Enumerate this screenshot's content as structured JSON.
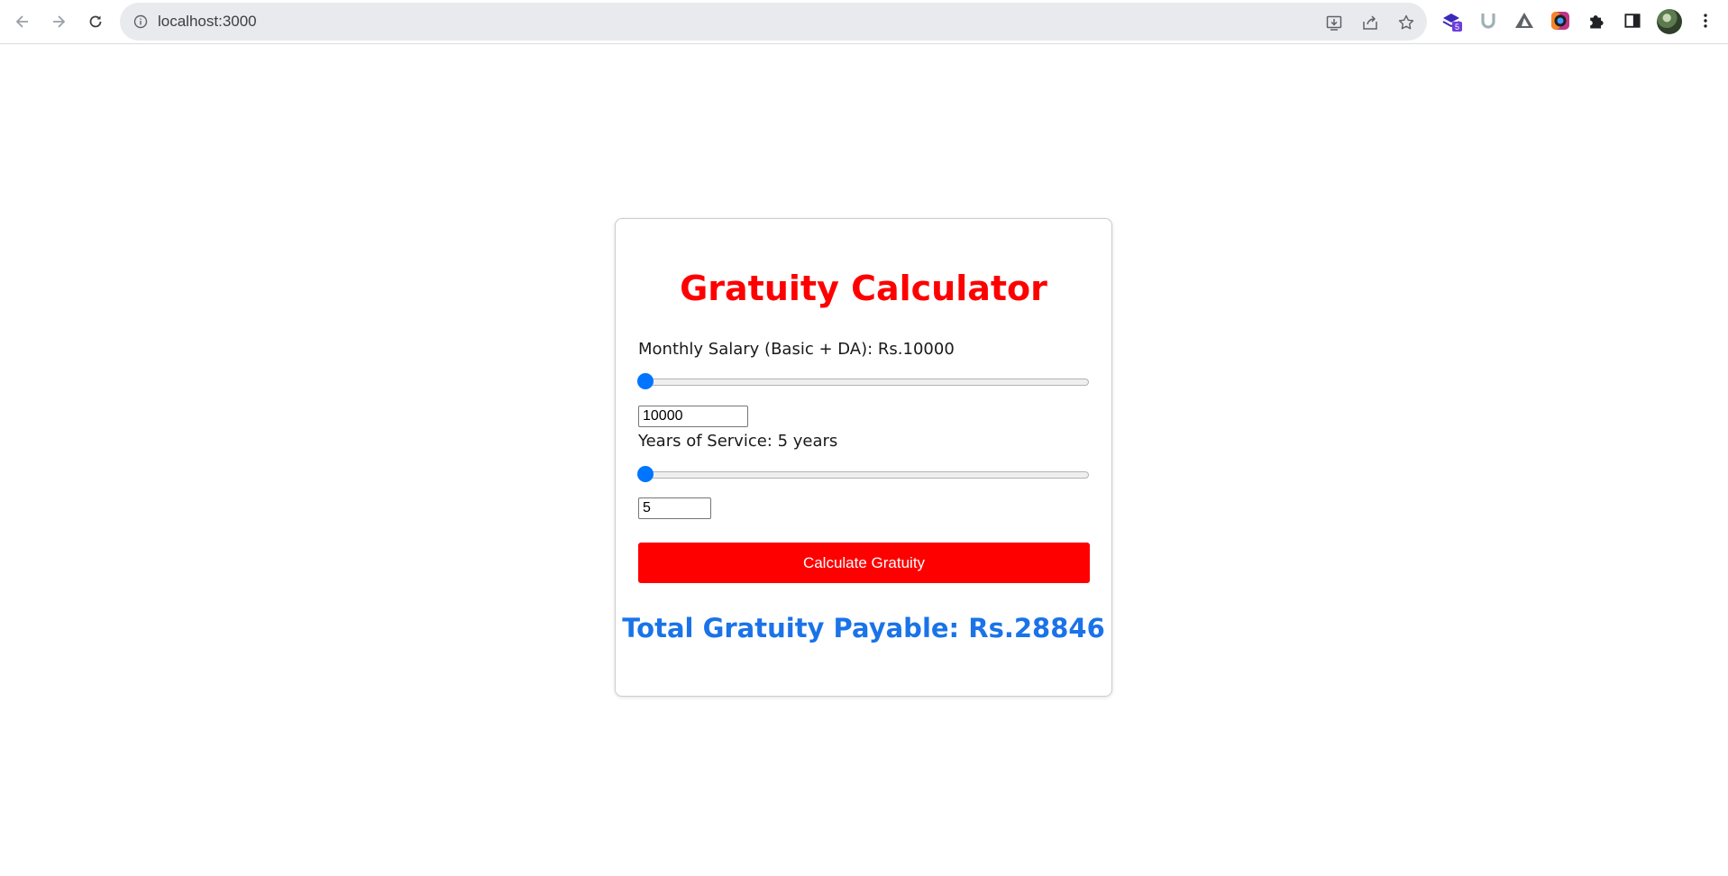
{
  "browser": {
    "url": "localhost:3000",
    "icons": {
      "back": "back-arrow-icon",
      "forward": "forward-arrow-icon",
      "reload": "reload-icon",
      "info": "info-icon",
      "install": "install-app-icon",
      "share": "share-icon",
      "bookmark": "star-icon"
    },
    "extensions": [
      "extension-stack-icon",
      "extension-u-icon",
      "extension-triangle-icon",
      "extension-color-ring-icon",
      "puzzle-icon",
      "side-panel-icon"
    ],
    "extension_badge": "5"
  },
  "calculator": {
    "title": "Gratuity Calculator",
    "salary": {
      "label": "Monthly Salary (Basic + DA): Rs.10000",
      "value": "10000",
      "slider_fraction": 0
    },
    "service": {
      "label": "Years of Service: 5 years",
      "value": "5",
      "slider_fraction": 0
    },
    "button_label": "Calculate Gratuity",
    "result": "Total Gratuity Payable: Rs.28846"
  },
  "colors": {
    "title": "#ff0000",
    "button": "#ff0000",
    "result": "#1a73e8",
    "slider_thumb": "#0075ff"
  }
}
